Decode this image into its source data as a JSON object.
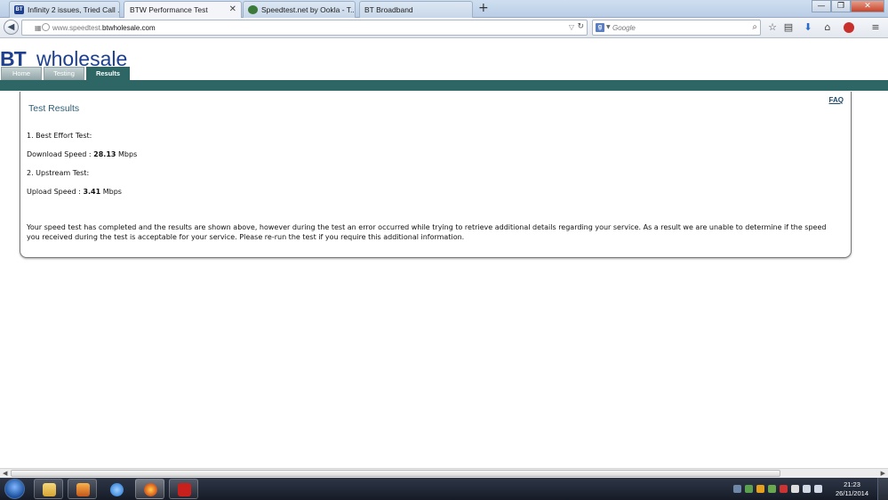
{
  "browser": {
    "tabs": [
      {
        "title": "Infinity 2 issues, Tried Call ...",
        "active": false,
        "favicon_color": "#1d3f8e"
      },
      {
        "title": "BTW Performance Test",
        "active": true,
        "favicon_color": ""
      },
      {
        "title": "Speedtest.net by Ookla - T...",
        "active": false,
        "favicon_color": "#3b7a3a"
      },
      {
        "title": "BT Broadband",
        "active": false,
        "favicon_color": ""
      }
    ],
    "new_tab_label": "+",
    "url_prefix": "www.speedtest.",
    "url_domain": "btwholesale.com",
    "search_placeholder": "Google"
  },
  "site": {
    "logo_bt": "BT",
    "logo_rest": "wholesale",
    "nav": [
      "Home",
      "Testing",
      "Results"
    ],
    "active_nav": "Results",
    "brand_color": "#2e6665"
  },
  "results": {
    "faq_label": "FAQ",
    "title": "Test Results",
    "test1_label": "1. Best Effort Test:",
    "download_label": "Download Speed :",
    "download_value": "28.13",
    "download_unit": "Mbps",
    "test2_label": "2. Upstream Test:",
    "upload_label": "Upload Speed :",
    "upload_value": "3.41",
    "upload_unit": "Mbps",
    "message": "Your speed test has completed and the results are shown above, however during the test an error occurred while trying to retrieve additional details regarding your service. As a result we are unable to determine if the speed you received during the test is acceptable for your service. Please re-run the test if you require this additional information."
  },
  "taskbar": {
    "time": "21:23",
    "date": "26/11/2014"
  }
}
